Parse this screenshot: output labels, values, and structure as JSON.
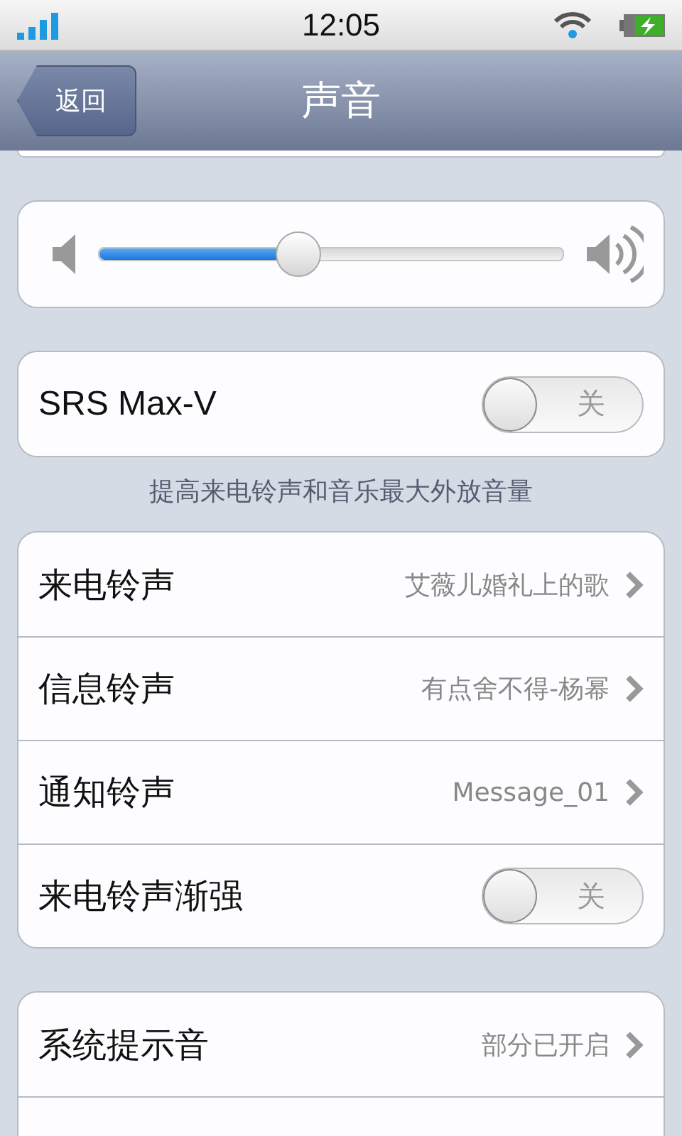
{
  "status_bar": {
    "time": "12:05"
  },
  "nav_bar": {
    "back": "返回",
    "title": "声音"
  },
  "volume": {
    "level": 0.43
  },
  "srs": {
    "label": "SRS Max-V",
    "on": false,
    "switch_text": "关",
    "caption": "提高来电铃声和音乐最大外放音量"
  },
  "ringtones": [
    {
      "kind": "link",
      "label": "来电铃声",
      "value": "艾薇儿婚礼上的歌"
    },
    {
      "kind": "link",
      "label": "信息铃声",
      "value": "有点舍不得-杨幂"
    },
    {
      "kind": "link",
      "label": "通知铃声",
      "value": "Message_01"
    },
    {
      "kind": "toggle",
      "label": "来电铃声渐强",
      "on": false,
      "switch_text": "关"
    }
  ],
  "system": [
    {
      "kind": "link",
      "label": "系统提示音",
      "value": "部分已开启"
    }
  ]
}
